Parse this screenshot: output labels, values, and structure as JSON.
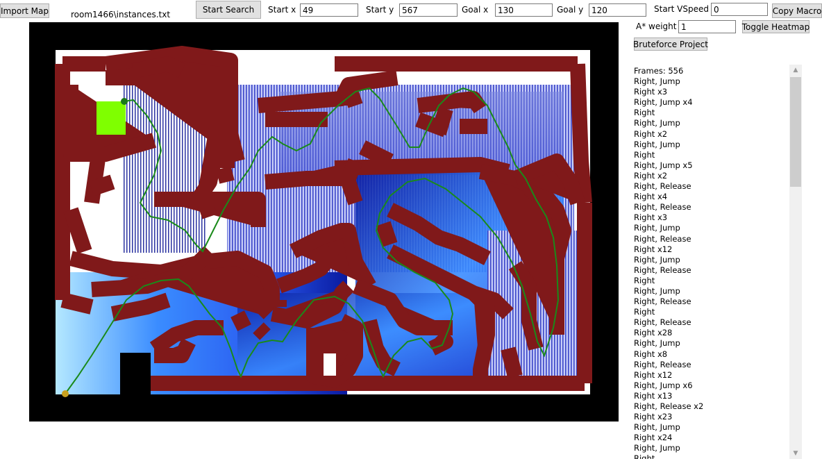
{
  "toolbar": {
    "import_map_label": "Import Map",
    "file_path": "room1466\\instances.txt",
    "start_search_label": "Start Search",
    "start_x_label": "Start x",
    "start_x_value": "49",
    "start_y_label": "Start y",
    "start_y_value": "567",
    "goal_x_label": "Goal x",
    "goal_x_value": "130",
    "goal_y_label": "Goal y",
    "goal_y_value": "120",
    "start_vspeed_label": "Start VSpeed",
    "start_vspeed_value": "0",
    "copy_macro_label": "Copy Macro",
    "astar_weight_label": "A* weight",
    "astar_weight_value": "1",
    "toggle_heatmap_label": "Toggle Heatmap",
    "bruteforce_label": "Bruteforce Project"
  },
  "colors": {
    "wall": "#80191a",
    "border": "#000000",
    "goal": "#7fff00",
    "path": "#1a8a1a",
    "start_marker": "#c8a01e",
    "heat_dark": "#0a1aa0",
    "heat_mid": "#3a8cff",
    "heat_light": "#b4e8ff"
  },
  "macro": {
    "frames": "Frames: 556",
    "items": [
      "Right, Jump",
      "Right x3",
      "Right, Jump x4",
      "Right",
      "Right, Jump",
      "Right x2",
      "Right, Jump",
      "Right",
      "Right, Jump x5",
      "Right x2",
      "Right, Release",
      "Right x4",
      "Right, Release",
      "Right x3",
      "Right, Jump",
      "Right, Release",
      "Right x12",
      "Right, Jump",
      "Right, Release",
      "Right",
      "Right, Jump",
      "Right, Release",
      "Right",
      "Right, Release",
      "Right x28",
      "Right, Jump",
      "Right x8",
      "Right, Release",
      "Right x12",
      "Right, Jump x6",
      "Right x13",
      "Right, Release x2",
      "Right x23",
      "Right, Jump",
      "Right x24",
      "Right, Jump",
      "Right"
    ]
  }
}
